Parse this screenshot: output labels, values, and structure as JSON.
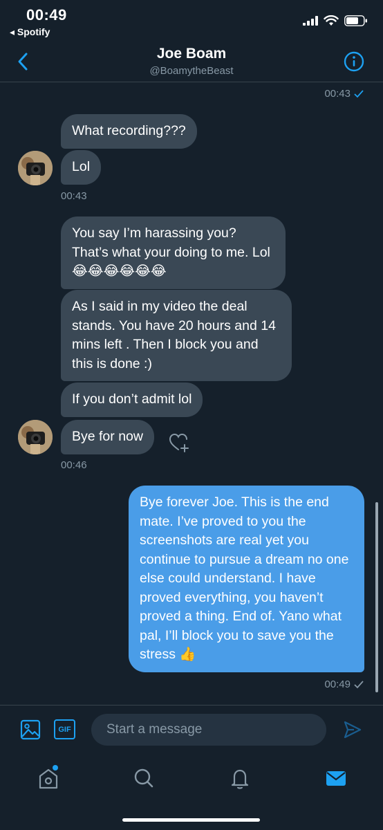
{
  "status": {
    "time": "00:49",
    "back_app": "◂ Spotify"
  },
  "header": {
    "title": "Joe Boam",
    "subtitle": "@BoamytheBeast"
  },
  "messages": {
    "top_time": "00:43",
    "m1": "What recording???",
    "m2": "Lol",
    "t1": "00:43",
    "m3": "You say I’m harassing you? That’s what your doing to me. Lol 😂😂😂😂😂😂",
    "m4": "As I said in my video the deal stands. You have 20 hours and 14 mins left . Then I block you and this is done :)",
    "m5": "If you don’t admit lol",
    "m6": "Bye for now",
    "t2": "00:46",
    "m7": "Bye forever Joe. This is the end mate. I’ve proved to you the screenshots are real yet you continue to pursue a dream no one else could understand. I have proved everything, you haven’t proved a thing. End of. Yano what pal, I’ll block you to save you the stress 👍",
    "t3": "00:49"
  },
  "composer": {
    "placeholder": "Start a message",
    "gif_label": "GIF"
  },
  "colors": {
    "background": "#15202b",
    "accent": "#1da1f2",
    "incoming_bubble": "#3a4855",
    "outgoing_bubble": "#4a9de8",
    "muted_text": "#8899a6"
  },
  "icons": [
    "signal-icon",
    "wifi-icon",
    "battery-icon",
    "back-arrow-icon",
    "info-icon",
    "heart-plus-icon",
    "image-icon",
    "gif-icon",
    "send-icon",
    "home-icon",
    "search-icon",
    "notifications-icon",
    "messages-icon"
  ]
}
